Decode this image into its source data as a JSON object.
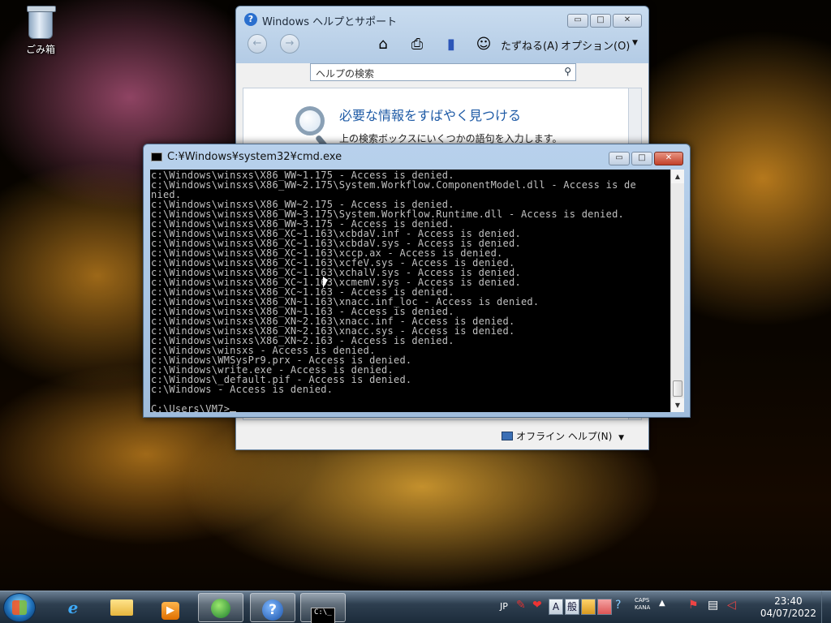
{
  "desktop": {
    "recycle_bin_label": "ごみ箱"
  },
  "help_window": {
    "title": "Windows ヘルプとサポート",
    "window_buttons": {
      "minimize": "▭",
      "maximize": "□",
      "close": "✕"
    },
    "toolbar": {
      "back_icon": "back-arrow-icon",
      "forward_icon": "forward-arrow-icon",
      "home_icon": "home-icon",
      "print_icon": "printer-icon",
      "browse_icon": "book-icon",
      "ask_icon": "people-icon",
      "ask_label": "たずねる(A)",
      "options_label": "オプション(O)",
      "options_chevron": "▼"
    },
    "search": {
      "placeholder": "ヘルプの検索"
    },
    "content": {
      "headline": "必要な情報をすばやく見つける",
      "subtext": "上の検索ボックスにいくつかの語句を入力します。"
    },
    "offline_help_label": "オフライン ヘルプ(N)",
    "offline_help_chevron": "▼"
  },
  "cmd_window": {
    "title": "C:¥Windows¥system32¥cmd.exe",
    "lines": [
      "c:\\Windows\\winsxs\\X86_WW~1.175 - Access is denied.",
      "c:\\Windows\\winsxs\\X86_WW~2.175\\System.Workflow.ComponentModel.dll - Access is de",
      "nied.",
      "c:\\Windows\\winsxs\\X86_WW~2.175 - Access is denied.",
      "c:\\Windows\\winsxs\\X86_WW~3.175\\System.Workflow.Runtime.dll - Access is denied.",
      "c:\\Windows\\winsxs\\X86_WW~3.175 - Access is denied.",
      "c:\\Windows\\winsxs\\X86_XC~1.163\\xcbdaV.inf - Access is denied.",
      "c:\\Windows\\winsxs\\X86_XC~1.163\\xcbdaV.sys - Access is denied.",
      "c:\\Windows\\winsxs\\X86_XC~1.163\\xccp.ax - Access is denied.",
      "c:\\Windows\\winsxs\\X86_XC~1.163\\xcfeV.sys - Access is denied.",
      "c:\\Windows\\winsxs\\X86_XC~1.163\\xchalV.sys - Access is denied.",
      "c:\\Windows\\winsxs\\X86_XC~1.163\\xcmemV.sys - Access is denied.",
      "c:\\Windows\\winsxs\\X86_XC~1.163 - Access is denied.",
      "c:\\Windows\\winsxs\\X86_XN~1.163\\xnacc.inf_loc - Access is denied.",
      "c:\\Windows\\winsxs\\X86_XN~1.163 - Access is denied.",
      "c:\\Windows\\winsxs\\X86_XN~2.163\\xnacc.inf - Access is denied.",
      "c:\\Windows\\winsxs\\X86_XN~2.163\\xnacc.sys - Access is denied.",
      "c:\\Windows\\winsxs\\X86_XN~2.163 - Access is denied.",
      "c:\\Windows\\winsxs - Access is denied.",
      "c:\\Windows\\WMSysPr9.prx - Access is denied.",
      "c:\\Windows\\write.exe - Access is denied.",
      "c:\\Windows\\_default.pif - Access is denied.",
      "c:\\Windows - Access is denied."
    ],
    "prompt": "C:\\Users\\VM7>"
  },
  "taskbar": {
    "start_icon": "windows-start-icon",
    "pinned": [
      {
        "name": "internet-explorer",
        "glyph": "e"
      },
      {
        "name": "file-explorer",
        "glyph": ""
      },
      {
        "name": "media-player",
        "glyph": "▶"
      },
      {
        "name": "network-app",
        "glyph": ""
      },
      {
        "name": "help-support",
        "glyph": "?"
      },
      {
        "name": "command-prompt",
        "glyph": "C:\\_"
      }
    ],
    "tray": {
      "language": "JP",
      "ime_mode": "A",
      "ime_kanji": "般",
      "caps_label": "CAPS",
      "kana_label": "KANA",
      "help_glyph": "?",
      "time": "23:40",
      "date": "04/07/2022"
    }
  }
}
